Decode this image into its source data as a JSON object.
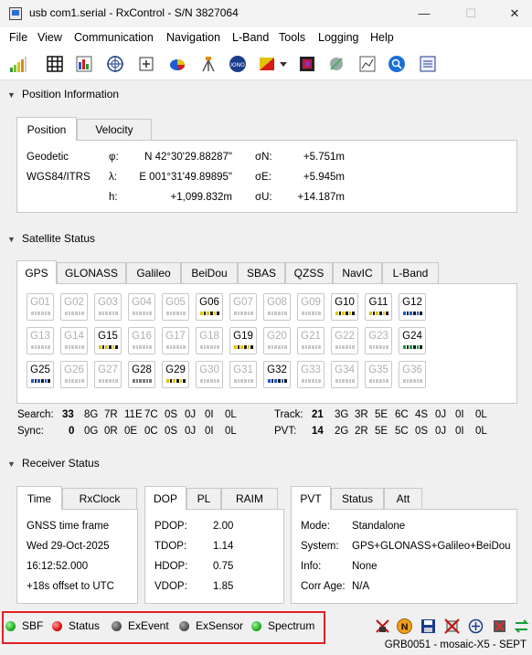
{
  "window": {
    "title": "usb com1.serial - RxControl - S/N 3827064"
  },
  "menu": [
    "File",
    "View",
    "Communication",
    "Navigation",
    "L-Band",
    "Tools",
    "Logging",
    "Help"
  ],
  "toolbar_icons": [
    "signal-bars-icon",
    "grid-icon",
    "skyplot-icon",
    "crosshair-icon",
    "expand-icon",
    "pie-chart-icon",
    "tripod-icon",
    "iono-icon",
    "flag-icon",
    "dropdown-arrow-icon",
    "spectrum-icon",
    "satellite-icon",
    "graph-icon",
    "search-icon",
    "list-icon"
  ],
  "position": {
    "header": "Position Information",
    "tabs": [
      "Position",
      "Velocity"
    ],
    "frame1": "Geodetic",
    "frame2": "WGS84/ITRS",
    "phi_label": "φ:",
    "phi_value": "N 42°30'29.88287\"",
    "lambda_label": "λ:",
    "lambda_value": "E 001°31'49.89895\"",
    "h_label": "h:",
    "h_value": "+1,099.832m",
    "sigN_label": "σN:",
    "sigN_value": "+5.751m",
    "sigE_label": "σE:",
    "sigE_value": "+5.945m",
    "sigU_label": "σU:",
    "sigU_value": "+14.187m"
  },
  "satellite": {
    "header": "Satellite Status",
    "tabs": [
      "GPS",
      "GLONASS",
      "Galileo",
      "BeiDou",
      "SBAS",
      "QZSS",
      "NavIC",
      "L-Band"
    ],
    "sats": [
      {
        "id": "G01",
        "s": "off"
      },
      {
        "id": "G02",
        "s": "off"
      },
      {
        "id": "G03",
        "s": "off"
      },
      {
        "id": "G04",
        "s": "off"
      },
      {
        "id": "G05",
        "s": "off"
      },
      {
        "id": "G06",
        "s": "y"
      },
      {
        "id": "G07",
        "s": "off"
      },
      {
        "id": "G08",
        "s": "off"
      },
      {
        "id": "G09",
        "s": "off"
      },
      {
        "id": "G10",
        "s": "y"
      },
      {
        "id": "G11",
        "s": "y"
      },
      {
        "id": "G12",
        "s": "b"
      },
      {
        "id": "G13",
        "s": "off"
      },
      {
        "id": "G14",
        "s": "off"
      },
      {
        "id": "G15",
        "s": "y"
      },
      {
        "id": "G16",
        "s": "off"
      },
      {
        "id": "G17",
        "s": "off"
      },
      {
        "id": "G18",
        "s": "off"
      },
      {
        "id": "G19",
        "s": "y"
      },
      {
        "id": "G20",
        "s": "off"
      },
      {
        "id": "G21",
        "s": "off"
      },
      {
        "id": "G22",
        "s": "off"
      },
      {
        "id": "G23",
        "s": "off"
      },
      {
        "id": "G24",
        "s": "g"
      },
      {
        "id": "G25",
        "s": "b"
      },
      {
        "id": "G26",
        "s": "off"
      },
      {
        "id": "G27",
        "s": "off"
      },
      {
        "id": "G28",
        "s": "on"
      },
      {
        "id": "G29",
        "s": "y"
      },
      {
        "id": "G30",
        "s": "off"
      },
      {
        "id": "G31",
        "s": "off"
      },
      {
        "id": "G32",
        "s": "b"
      },
      {
        "id": "G33",
        "s": "off"
      },
      {
        "id": "G34",
        "s": "off"
      },
      {
        "id": "G35",
        "s": "off"
      },
      {
        "id": "G36",
        "s": "off"
      }
    ],
    "search_label": "Search:",
    "search_total": "33",
    "search_items": [
      "8G",
      "7R",
      "11E",
      "7C",
      "0S",
      "0J",
      "0I",
      "0L"
    ],
    "sync_label": "Sync:",
    "sync_total": "0",
    "sync_items": [
      "0G",
      "0R",
      "0E",
      "0C",
      "0S",
      "0J",
      "0I",
      "0L"
    ],
    "track_label": "Track:",
    "track_total": "21",
    "track_items": [
      "3G",
      "3R",
      "5E",
      "6C",
      "4S",
      "0J",
      "0I",
      "0L"
    ],
    "pvt_label": "PVT:",
    "pvt_total": "14",
    "pvt_items": [
      "2G",
      "2R",
      "5E",
      "5C",
      "0S",
      "0J",
      "0I",
      "0L"
    ]
  },
  "receiver": {
    "header": "Receiver Status",
    "time_tabs": [
      "Time",
      "RxClock"
    ],
    "time_lines": [
      "GNSS time frame",
      "Wed 29-Oct-2025",
      "16:12:52.000",
      "+18s offset to UTC"
    ],
    "dop_tabs": [
      "DOP",
      "PL",
      "RAIM"
    ],
    "dop": [
      {
        "k": "PDOP:",
        "v": "2.00"
      },
      {
        "k": "TDOP:",
        "v": "1.14"
      },
      {
        "k": "HDOP:",
        "v": "0.75"
      },
      {
        "k": "VDOP:",
        "v": "1.85"
      }
    ],
    "pvt_tabs": [
      "PVT",
      "Status",
      "Att"
    ],
    "pvt": [
      {
        "k": "Mode:",
        "v": "Standalone"
      },
      {
        "k": "System:",
        "v": "GPS+GLONASS+Galileo+BeiDou"
      },
      {
        "k": "Info:",
        "v": "None"
      },
      {
        "k": "Corr Age:",
        "v": "N/A"
      }
    ]
  },
  "status_bar": {
    "indicators": [
      {
        "label": "SBF",
        "color": "green"
      },
      {
        "label": "Status",
        "color": "red"
      },
      {
        "label": "ExEvent",
        "color": "grey"
      },
      {
        "label": "ExSensor",
        "color": "grey"
      },
      {
        "label": "Spectrum",
        "color": "green"
      }
    ],
    "footer": "GRB0051 - mosaic-X5 - SEPT"
  }
}
